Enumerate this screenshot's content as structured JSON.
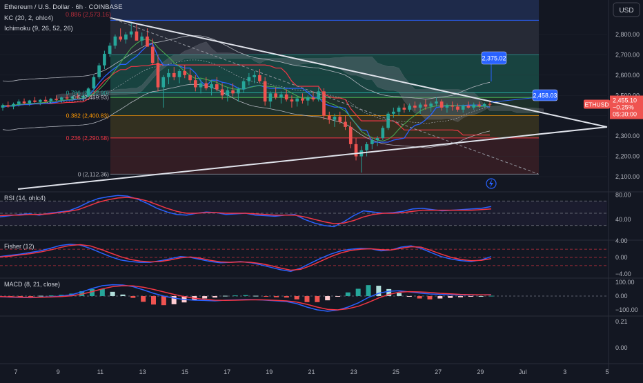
{
  "header": {
    "symbol_line": "Ethereum / U.S. Dollar · 6h · COINBASE",
    "indicator_kc": "KC (20, 2, ohlc4)",
    "indicator_ichimoku": "Ichimoku (9, 26, 52, 26)",
    "fib_top_overlap": "0.886 (2,573.16)"
  },
  "currency_button": "USD",
  "colors": {
    "background": "#131722",
    "bull": "#26a69a",
    "bear": "#ef5350",
    "blue_line": "#2962ff",
    "red_line": "#f23645",
    "accent_box": "#2962ff"
  },
  "chart_data": [
    {
      "type": "candlestick",
      "panel": "price",
      "y_axis_ticks": [
        "2,800.00",
        "2,700.00",
        "2,600.00",
        "2,500.00",
        "2,400.00",
        "2,300.00",
        "2,200.00",
        "2,100.00"
      ],
      "ylim": [
        2100,
        2880
      ],
      "fib_levels": [
        {
          "label": "0.786 (2,512.90)",
          "ratio": 0.786,
          "price": 2512.9,
          "fill": "#1b5e55"
        },
        {
          "label": "0.5 (2,489.93)",
          "ratio": 0.5,
          "price": 2489.93,
          "fill": "#2b4a2e"
        },
        {
          "label": "0.382 (2,400.83)",
          "ratio": 0.382,
          "price": 2400.83,
          "fill": "#3a3a22"
        },
        {
          "label": "0.236 (2,290.58)",
          "ratio": 0.236,
          "price": 2290.58,
          "fill": "#3b2020"
        },
        {
          "label": "0 (2,112.36)",
          "ratio": 0,
          "price": 2112.36,
          "fill": "#2c1b20"
        }
      ],
      "callouts": [
        {
          "label": "2,375.02",
          "price": 2375.02
        },
        {
          "label": "2,458.03",
          "price": 2458.03
        }
      ],
      "price_tag": {
        "symbol": "ETHUSD",
        "price": "2,455.10",
        "change": "−0.25%",
        "timer": "05:30:00",
        "value": 2455.1
      },
      "candles": [
        [
          2440,
          2460,
          2425,
          2452
        ],
        [
          2452,
          2470,
          2440,
          2445
        ],
        [
          2445,
          2465,
          2432,
          2458
        ],
        [
          2458,
          2480,
          2445,
          2470
        ],
        [
          2470,
          2485,
          2455,
          2462
        ],
        [
          2462,
          2478,
          2448,
          2475
        ],
        [
          2475,
          2492,
          2462,
          2468
        ],
        [
          2468,
          2482,
          2452,
          2478
        ],
        [
          2478,
          2495,
          2465,
          2470
        ],
        [
          2470,
          2488,
          2458,
          2484
        ],
        [
          2484,
          2500,
          2470,
          2478
        ],
        [
          2478,
          2494,
          2464,
          2490
        ],
        [
          2490,
          2506,
          2478,
          2485
        ],
        [
          2485,
          2500,
          2472,
          2495
        ],
        [
          2495,
          2512,
          2482,
          2489
        ],
        [
          2489,
          2504,
          2476,
          2498
        ],
        [
          2498,
          2540,
          2490,
          2534
        ],
        [
          2534,
          2600,
          2525,
          2590
        ],
        [
          2590,
          2660,
          2580,
          2648
        ],
        [
          2648,
          2720,
          2630,
          2705
        ],
        [
          2705,
          2760,
          2690,
          2745
        ],
        [
          2745,
          2800,
          2730,
          2790
        ],
        [
          2790,
          2830,
          2765,
          2775
        ],
        [
          2775,
          2812,
          2755,
          2800
        ],
        [
          2800,
          2860,
          2785,
          2815
        ],
        [
          2815,
          2850,
          2790,
          2770
        ],
        [
          2770,
          2810,
          2745,
          2790
        ],
        [
          2790,
          2830,
          2770,
          2740
        ],
        [
          2740,
          2780,
          2650,
          2660
        ],
        [
          2660,
          2700,
          2520,
          2540
        ],
        [
          2540,
          2600,
          2440,
          2590
        ],
        [
          2590,
          2630,
          2555,
          2610
        ],
        [
          2610,
          2640,
          2575,
          2590
        ],
        [
          2590,
          2630,
          2560,
          2620
        ],
        [
          2620,
          2650,
          2585,
          2600
        ],
        [
          2600,
          2630,
          2560,
          2575
        ],
        [
          2575,
          2600,
          2520,
          2540
        ],
        [
          2540,
          2580,
          2510,
          2560
        ],
        [
          2560,
          2590,
          2525,
          2535
        ],
        [
          2535,
          2570,
          2500,
          2555
        ],
        [
          2555,
          2590,
          2520,
          2530
        ],
        [
          2530,
          2560,
          2480,
          2500
        ],
        [
          2500,
          2540,
          2470,
          2525
        ],
        [
          2525,
          2560,
          2495,
          2510
        ],
        [
          2510,
          2540,
          2470,
          2530
        ],
        [
          2530,
          2580,
          2515,
          2570
        ],
        [
          2570,
          2610,
          2550,
          2590
        ],
        [
          2590,
          2620,
          2560,
          2600
        ],
        [
          2600,
          2630,
          2560,
          2570
        ],
        [
          2570,
          2590,
          2450,
          2470
        ],
        [
          2470,
          2520,
          2440,
          2510
        ],
        [
          2510,
          2540,
          2480,
          2490
        ],
        [
          2490,
          2520,
          2460,
          2505
        ],
        [
          2505,
          2530,
          2470,
          2480
        ],
        [
          2480,
          2500,
          2440,
          2470
        ],
        [
          2470,
          2495,
          2445,
          2485
        ],
        [
          2485,
          2510,
          2460,
          2475
        ],
        [
          2475,
          2500,
          2450,
          2490
        ],
        [
          2490,
          2520,
          2470,
          2480
        ],
        [
          2480,
          2540,
          2470,
          2520
        ],
        [
          2520,
          2535,
          2380,
          2400
        ],
        [
          2400,
          2420,
          2360,
          2380
        ],
        [
          2380,
          2410,
          2345,
          2395
        ],
        [
          2395,
          2420,
          2360,
          2370
        ],
        [
          2370,
          2400,
          2330,
          2345
        ],
        [
          2345,
          2370,
          2240,
          2260
        ],
        [
          2260,
          2290,
          2180,
          2200
        ],
        [
          2200,
          2250,
          2120,
          2230
        ],
        [
          2230,
          2270,
          2200,
          2260
        ],
        [
          2260,
          2290,
          2235,
          2280
        ],
        [
          2280,
          2300,
          2250,
          2290
        ],
        [
          2290,
          2350,
          2280,
          2340
        ],
        [
          2340,
          2420,
          2330,
          2410
        ],
        [
          2410,
          2440,
          2390,
          2420
        ],
        [
          2420,
          2450,
          2400,
          2440
        ],
        [
          2440,
          2460,
          2415,
          2430
        ],
        [
          2430,
          2460,
          2420,
          2450
        ],
        [
          2450,
          2470,
          2425,
          2440
        ],
        [
          2440,
          2465,
          2410,
          2455
        ],
        [
          2455,
          2480,
          2430,
          2445
        ],
        [
          2445,
          2470,
          2420,
          2460
        ],
        [
          2460,
          2490,
          2445,
          2470
        ],
        [
          2470,
          2480,
          2425,
          2440
        ],
        [
          2440,
          2460,
          2415,
          2450
        ],
        [
          2450,
          2470,
          2425,
          2445
        ],
        [
          2445,
          2460,
          2420,
          2430
        ],
        [
          2430,
          2455,
          2415,
          2450
        ],
        [
          2450,
          2470,
          2435,
          2440
        ],
        [
          2440,
          2465,
          2430,
          2455
        ],
        [
          2455,
          2470,
          2440,
          2448
        ],
        [
          2448,
          2465,
          2440,
          2458
        ],
        [
          2458,
          2470,
          2445,
          2455
        ]
      ]
    },
    {
      "type": "line",
      "panel": "rsi",
      "title": "RSI (14, ohlc4)",
      "ticks": [
        "80.00",
        "40.00"
      ],
      "ylim": [
        15,
        85
      ],
      "upper_band": 70,
      "lower_band": 30,
      "series": [
        {
          "values": [
            44,
            46,
            48,
            49,
            47,
            50,
            52,
            54,
            60,
            68,
            74,
            77,
            79,
            78,
            73,
            66,
            58,
            52,
            48,
            47,
            50,
            52,
            51,
            48,
            49,
            50,
            47,
            46,
            45,
            47,
            48,
            40,
            34,
            30,
            28,
            36,
            46,
            54,
            52,
            50,
            51,
            53,
            57,
            58,
            56,
            54,
            55,
            56,
            57,
            58,
            61
          ]
        },
        {
          "values": [
            46,
            47,
            47,
            48,
            48,
            49,
            51,
            53,
            56,
            62,
            68,
            72,
            75,
            76,
            74,
            70,
            64,
            58,
            53,
            50,
            50,
            51,
            51,
            50,
            50,
            50,
            49,
            48,
            47,
            47,
            47,
            44,
            40,
            36,
            33,
            34,
            38,
            44,
            48,
            50,
            50,
            51,
            53,
            55,
            55,
            55,
            55,
            55,
            55,
            56,
            57
          ]
        }
      ]
    },
    {
      "type": "line",
      "panel": "fisher",
      "title": "Fisher (12)",
      "ticks": [
        "4.00",
        "0.00",
        "−4.00"
      ],
      "ylim": [
        -4.2,
        4.2
      ],
      "levels": [
        2.0,
        0.0,
        -2.0
      ],
      "series": [
        {
          "values": [
            0.2,
            0.5,
            0.8,
            1.2,
            1.6,
            2.2,
            2.9,
            3.2,
            3.0,
            2.2,
            1.2,
            0.2,
            -0.6,
            -1.0,
            -1.2,
            -1.2,
            -0.8,
            -0.3,
            0.2,
            0.0,
            -0.5,
            -1.0,
            -1.3,
            -1.2,
            -1.0,
            -1.3,
            -1.8,
            -2.4,
            -3.0,
            -3.4,
            -2.6,
            -1.4,
            -0.2,
            0.8,
            1.6,
            2.0,
            2.2,
            2.1,
            1.6,
            1.8,
            2.5,
            2.8,
            2.2,
            1.2,
            0.2,
            -0.4,
            -0.8,
            -1.0,
            -0.6,
            0.2
          ]
        },
        {
          "values": [
            0.1,
            0.3,
            0.6,
            0.9,
            1.3,
            1.8,
            2.4,
            2.9,
            3.1,
            2.8,
            2.0,
            1.1,
            0.2,
            -0.5,
            -0.9,
            -1.1,
            -1.0,
            -0.6,
            -0.1,
            0.1,
            -0.2,
            -0.7,
            -1.1,
            -1.2,
            -1.1,
            -1.2,
            -1.5,
            -2.0,
            -2.6,
            -3.1,
            -2.9,
            -2.0,
            -0.9,
            0.2,
            1.1,
            1.7,
            2.0,
            2.1,
            1.9,
            1.8,
            2.2,
            2.6,
            2.5,
            1.7,
            0.8,
            0.0,
            -0.5,
            -0.8,
            -0.7,
            -0.3
          ]
        }
      ]
    },
    {
      "type": "bar+line",
      "panel": "macd",
      "title": "MACD (8, 21, close)",
      "ticks": [
        "100.00",
        "0.00",
        "−100.00"
      ],
      "ylim": [
        -130,
        130
      ],
      "series": [
        {
          "values": [
            -5,
            -8,
            -10,
            -12,
            -8,
            -5,
            0,
            10,
            30,
            55,
            75,
            82,
            80,
            68,
            45,
            20,
            0,
            -15,
            -25,
            -30,
            -32,
            -35,
            -30,
            -28,
            -25,
            -26,
            -30,
            -35,
            -40,
            -55,
            -80,
            -100,
            -110,
            -102,
            -80,
            -50,
            -10,
            20,
            35,
            38,
            30,
            22,
            15,
            12,
            10,
            8,
            8,
            9,
            10
          ]
        },
        {
          "values": [
            -4,
            -6,
            -8,
            -10,
            -9,
            -7,
            -4,
            2,
            14,
            32,
            52,
            68,
            75,
            74,
            64,
            48,
            30,
            12,
            -4,
            -16,
            -24,
            -30,
            -31,
            -30,
            -28,
            -27,
            -28,
            -31,
            -35,
            -44,
            -60,
            -80,
            -96,
            -100,
            -92,
            -74,
            -46,
            -14,
            12,
            28,
            32,
            30,
            26,
            20,
            16,
            12,
            10,
            9,
            9
          ]
        }
      ]
    }
  ],
  "time_axis": [
    "7",
    "9",
    "11",
    "13",
    "15",
    "17",
    "19",
    "21",
    "23",
    "25",
    "27",
    "29",
    "Jul",
    "3",
    "5"
  ],
  "bottom_axis_ticks": [
    "0.21",
    "0.00"
  ]
}
